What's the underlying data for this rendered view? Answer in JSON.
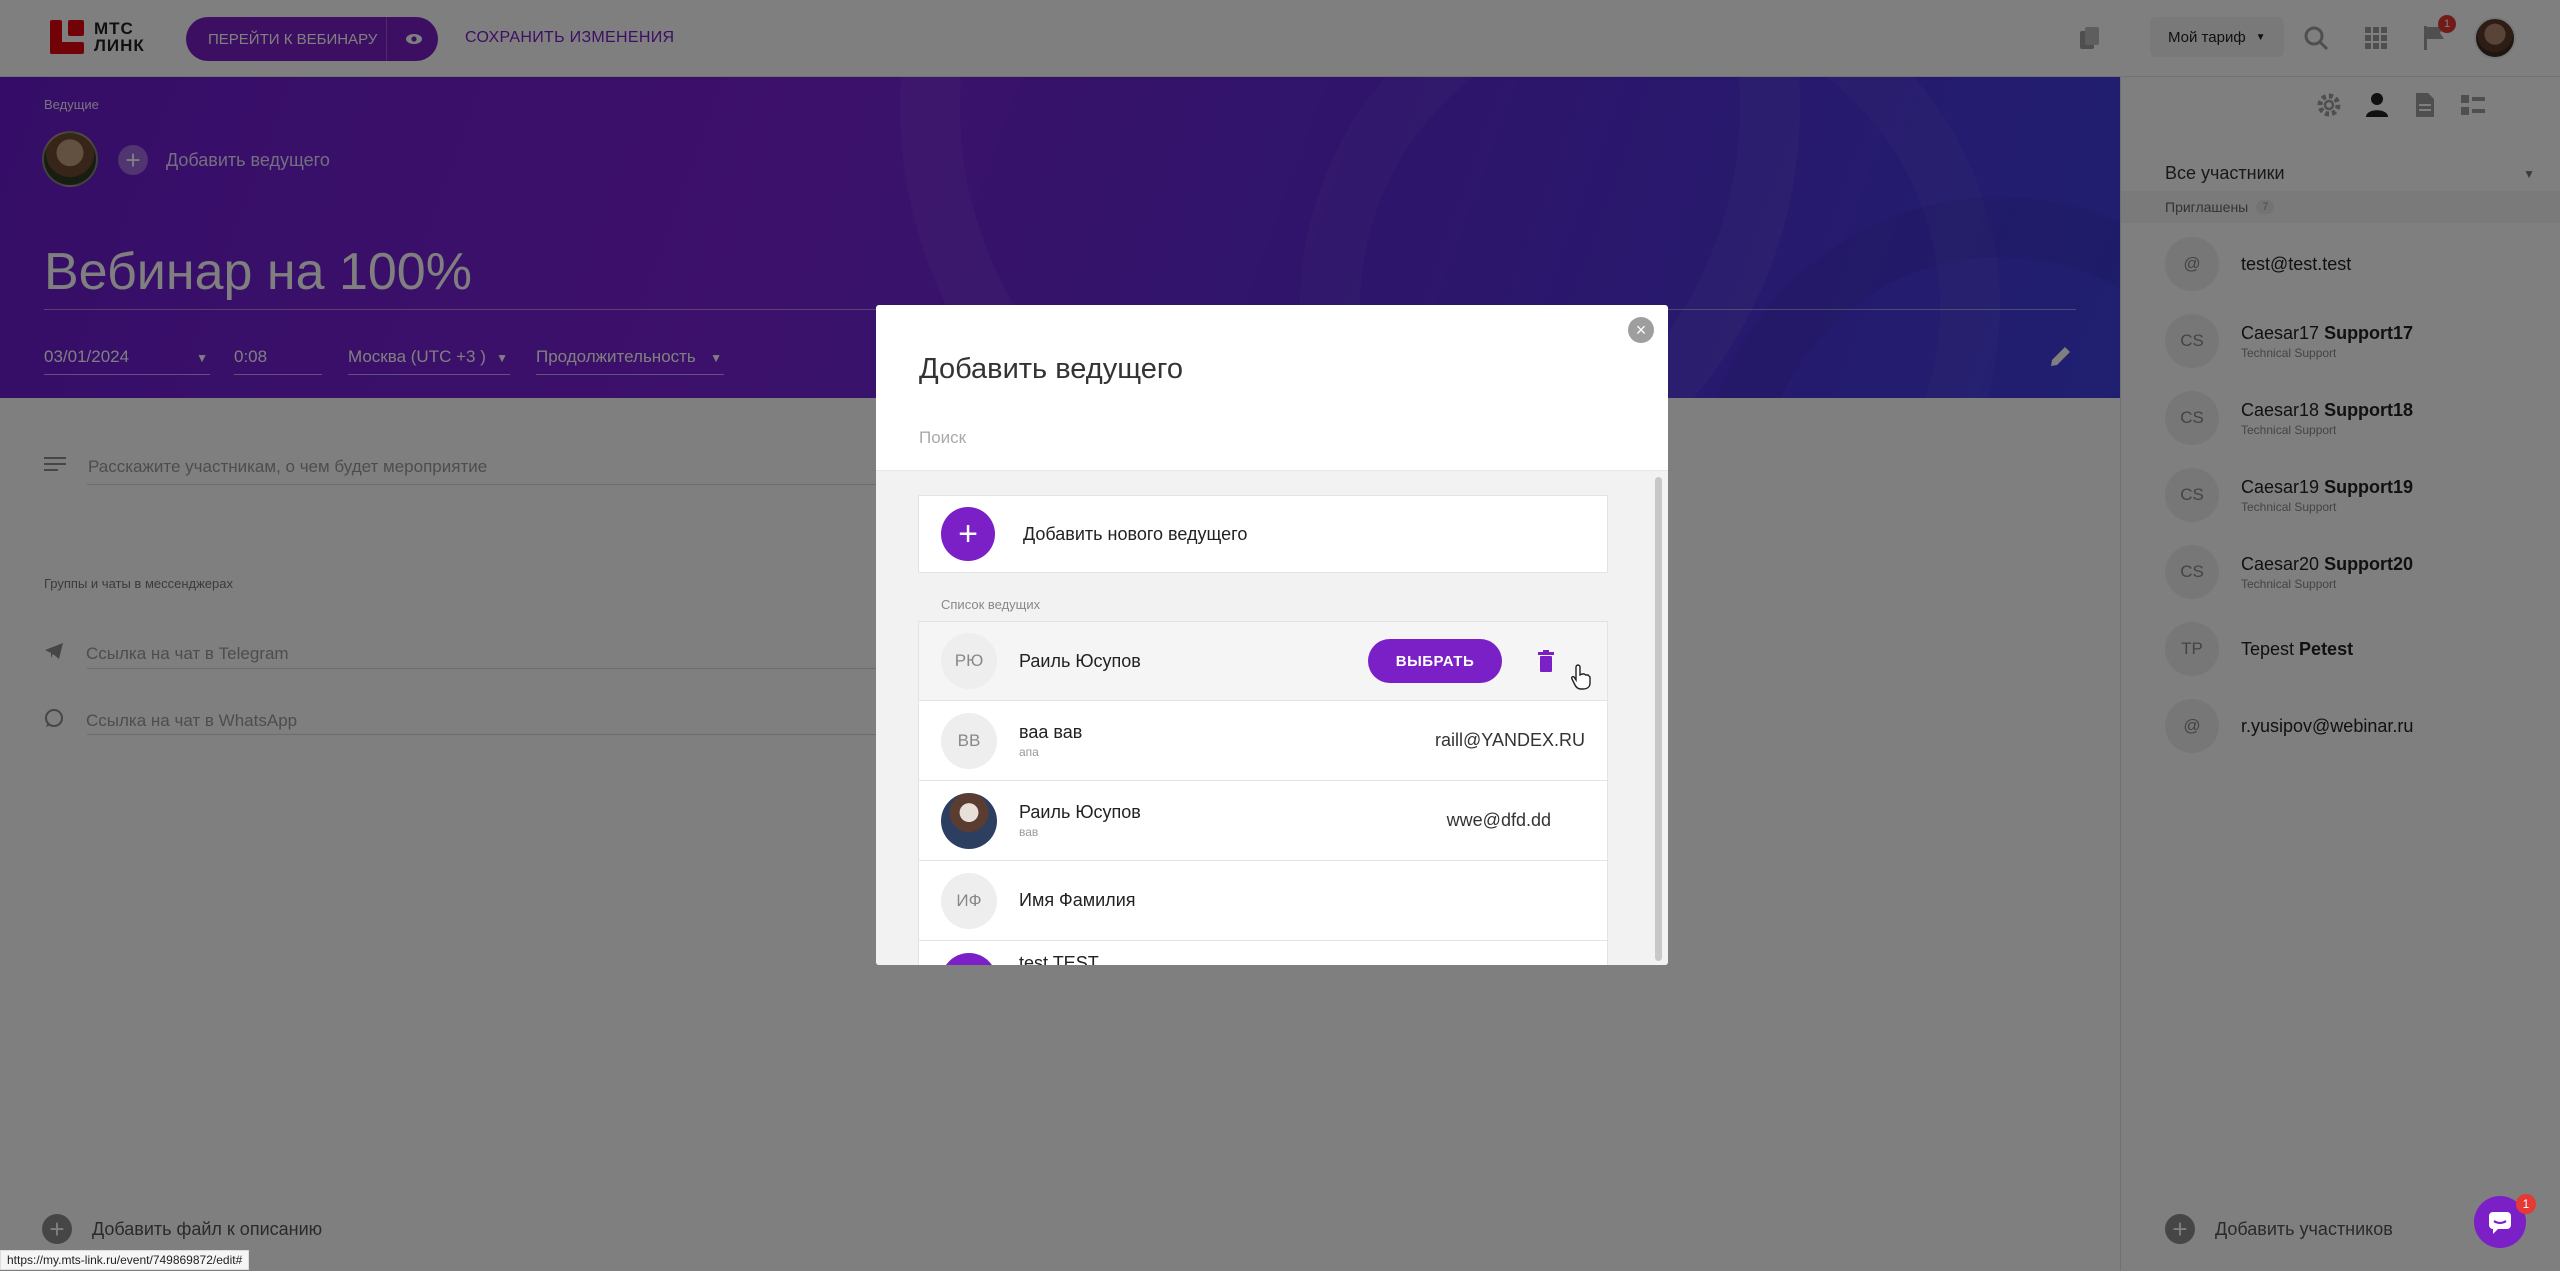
{
  "topbar": {
    "logo_line1": "МТС",
    "logo_line2": "ЛИНК",
    "go_webinar_label": "ПЕРЕЙТИ К ВЕБИНАРУ",
    "save_label": "СОХРАНИТЬ ИЗМЕНЕНИЯ",
    "tarif_label": "Мой тариф",
    "notification_count": "1",
    "icons": [
      "copy-icon",
      "search-icon",
      "apps-grid-icon",
      "flag-icon",
      "avatar"
    ]
  },
  "hero": {
    "hosts_label": "Ведущие",
    "add_host_label": "Добавить ведущего",
    "title": "Вебинар на 100%",
    "date": "03/01/2024",
    "time": "0:08",
    "timezone": "Москва (UTC +3 )",
    "duration_placeholder": "Продолжительность"
  },
  "main": {
    "description_placeholder": "Расскажите участникам, о чем будет мероприятие",
    "groups_label": "Группы и чаты в мессенджерах",
    "telegram_placeholder": "Ссылка на чат в Telegram",
    "whatsapp_placeholder": "Ссылка на чат в WhatsApp",
    "add_file_label": "Добавить файл к описанию"
  },
  "right_panel": {
    "filter_value": "Все участники",
    "invited_label": "Приглашены",
    "invited_count": "7",
    "participants": [
      {
        "initials": "@",
        "name": "test@test.test",
        "bold": "",
        "sub": ""
      },
      {
        "initials": "CS",
        "name": "Caesar17 ",
        "bold": "Support17",
        "sub": "Technical Support"
      },
      {
        "initials": "CS",
        "name": "Caesar18 ",
        "bold": "Support18",
        "sub": "Technical Support"
      },
      {
        "initials": "CS",
        "name": "Caesar19 ",
        "bold": "Support19",
        "sub": "Technical Support"
      },
      {
        "initials": "CS",
        "name": "Caesar20 ",
        "bold": "Support20",
        "sub": "Technical Support"
      },
      {
        "initials": "TP",
        "name": "Tepest ",
        "bold": "Petest",
        "sub": ""
      },
      {
        "initials": "@",
        "name": "r.yusipov@webinar.ru",
        "bold": "",
        "sub": ""
      }
    ],
    "add_participants_label": "Добавить участников"
  },
  "modal": {
    "title": "Добавить ведущего",
    "search_placeholder": "Поиск",
    "add_new_label": "Добавить нового ведущего",
    "list_label": "Список ведущих",
    "choose_label": "ВЫБРАТЬ",
    "hosts": [
      {
        "initials": "РЮ",
        "name": "Раиль Юсупов",
        "sub": "",
        "email": ""
      },
      {
        "initials": "ВВ",
        "name": "ваа вав",
        "sub": "апа",
        "email": "raill@YANDEX.RU"
      },
      {
        "initials": "",
        "name": "Раиль Юсупов",
        "sub": "вав",
        "email": "wwe@dfd.dd"
      },
      {
        "initials": "ИФ",
        "name": "Имя Фамилия",
        "sub": "",
        "email": ""
      },
      {
        "initials": "",
        "name": "test TEST",
        "sub": "",
        "email": ""
      }
    ]
  },
  "status_url": "https://my.mts-link.ru/event/749869872/edit#",
  "chat_badge": "1",
  "colors": {
    "accent": "#7b1fc7",
    "brand_red": "#e30611",
    "badge_red": "#e53935"
  }
}
